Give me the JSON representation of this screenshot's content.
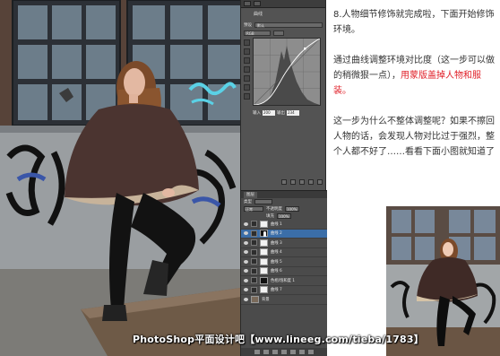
{
  "photoshop_panel": {
    "curve_title": "曲线",
    "preset_label": "预设",
    "preset_value": "默认",
    "channel_value": "RGB",
    "input_label": "输入",
    "input_value": "200",
    "output_label": "输出",
    "output_value": "234",
    "layers_tab": "图层",
    "kind_label": "类型",
    "blend_mode": "正常",
    "opacity_label": "不透明度",
    "opacity_value": "100%",
    "fill_label": "填充",
    "fill_value": "100%",
    "layers": [
      {
        "name": "曲线 1",
        "mask": "white",
        "selected": false
      },
      {
        "name": "曲线 2",
        "mask": "fig",
        "selected": true
      },
      {
        "name": "曲线 3",
        "mask": "white",
        "selected": false
      },
      {
        "name": "曲线 4",
        "mask": "white",
        "selected": false
      },
      {
        "name": "曲线 5",
        "mask": "white",
        "selected": false
      },
      {
        "name": "曲线 6",
        "mask": "white",
        "selected": false
      },
      {
        "name": "色相/饱和度 1",
        "mask": "black",
        "selected": false
      },
      {
        "name": "曲线 7",
        "mask": "white",
        "selected": false
      },
      {
        "name": "背景",
        "mask": "none",
        "selected": false
      }
    ]
  },
  "article": {
    "para1": "8.人物细节修饰就完成啦，下面开始修饰环境。",
    "para2_normal": "通过曲线调整环境对比度（这一步可以做的稍微狠一点），",
    "para2_red": "用蒙版盖掉人物和服装。",
    "para3": "这一步为什么不整体调整呢？如果不擦回人物的话，会发现人物对比过于强烈，整个人都不好了……看看下面小图就知道了"
  },
  "watermark": "PhotoShop平面设计吧【www.lineeg.com/tieba/1783】",
  "colors": {
    "accent_red": "#e0212a",
    "text": "#333333",
    "panel_bg": "#535353",
    "selected_layer": "#3b6ea8"
  }
}
